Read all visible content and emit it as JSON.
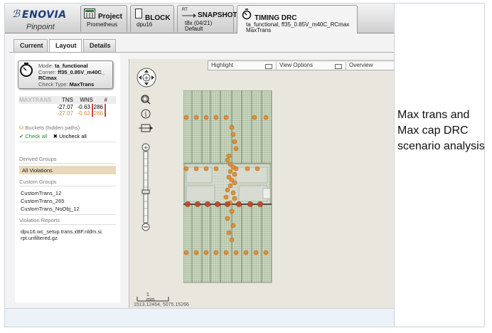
{
  "header": {
    "brand": "ENOVIA",
    "product": "Pinpoint",
    "tabs": [
      {
        "label": "Project",
        "sub1": "Prometheus",
        "sub2": ""
      },
      {
        "label": "BLOCK",
        "sub1": "dpu16",
        "sub2": ""
      },
      {
        "label": "SNAPSHOT",
        "prefix": "RT",
        "sub1": "t8x (04/21)",
        "sub2": "Default"
      },
      {
        "label": "TIMING DRC",
        "sub1": "ta_functional, ff35_0.85V_m40C_RCmax",
        "sub2": "MaxTrans"
      }
    ]
  },
  "subtabs": [
    "Current",
    "Layout",
    "Details"
  ],
  "drc": {
    "mode_label": "Mode:",
    "mode_value": "ta_functional",
    "corner_label": "Corner:",
    "corner_value": "ff35_0.85V_m40C_",
    "corner_value2": "RCmax",
    "check_label": "Check Type:",
    "check_value": "MaxTrans"
  },
  "stats": {
    "title": "MAXTRANS",
    "columns": [
      "TNS",
      "WNS",
      "#"
    ],
    "rows": [
      [
        "-27.07",
        "-0.63",
        "286"
      ],
      [
        "-27.07",
        "-0.63",
        "286"
      ]
    ]
  },
  "buckets_label": "Buckets (hidden paths)",
  "check_all": "Check all",
  "uncheck_all": "Uncheck all",
  "derived_title": "Derived Groups",
  "all_violations": "All Violations",
  "custom_title": "Custom Groups",
  "custom_groups": [
    "CustomTrans_12",
    "CustomTrans_265",
    "CustomTrans_NoObj_12"
  ],
  "reports_title": "Violation Reports",
  "report_line1": "dpu16.wc_setup.trans.xBF.nldm.si.",
  "report_line2": "rpt.unfiltered.gz",
  "mapbar": {
    "highlight": "Highlight",
    "view_options": "View Options",
    "overview": "Overview"
  },
  "scale_label": "1 mm",
  "coords": "1513.12464, 5075.15266",
  "caption": "Max trans and Max cap DRC scenario analysis",
  "colors": {
    "violation": "#e0892c",
    "violation_dark": "#c8461f",
    "accent_brand": "#1f3a77",
    "selected_bg": "#e7d9bb"
  }
}
